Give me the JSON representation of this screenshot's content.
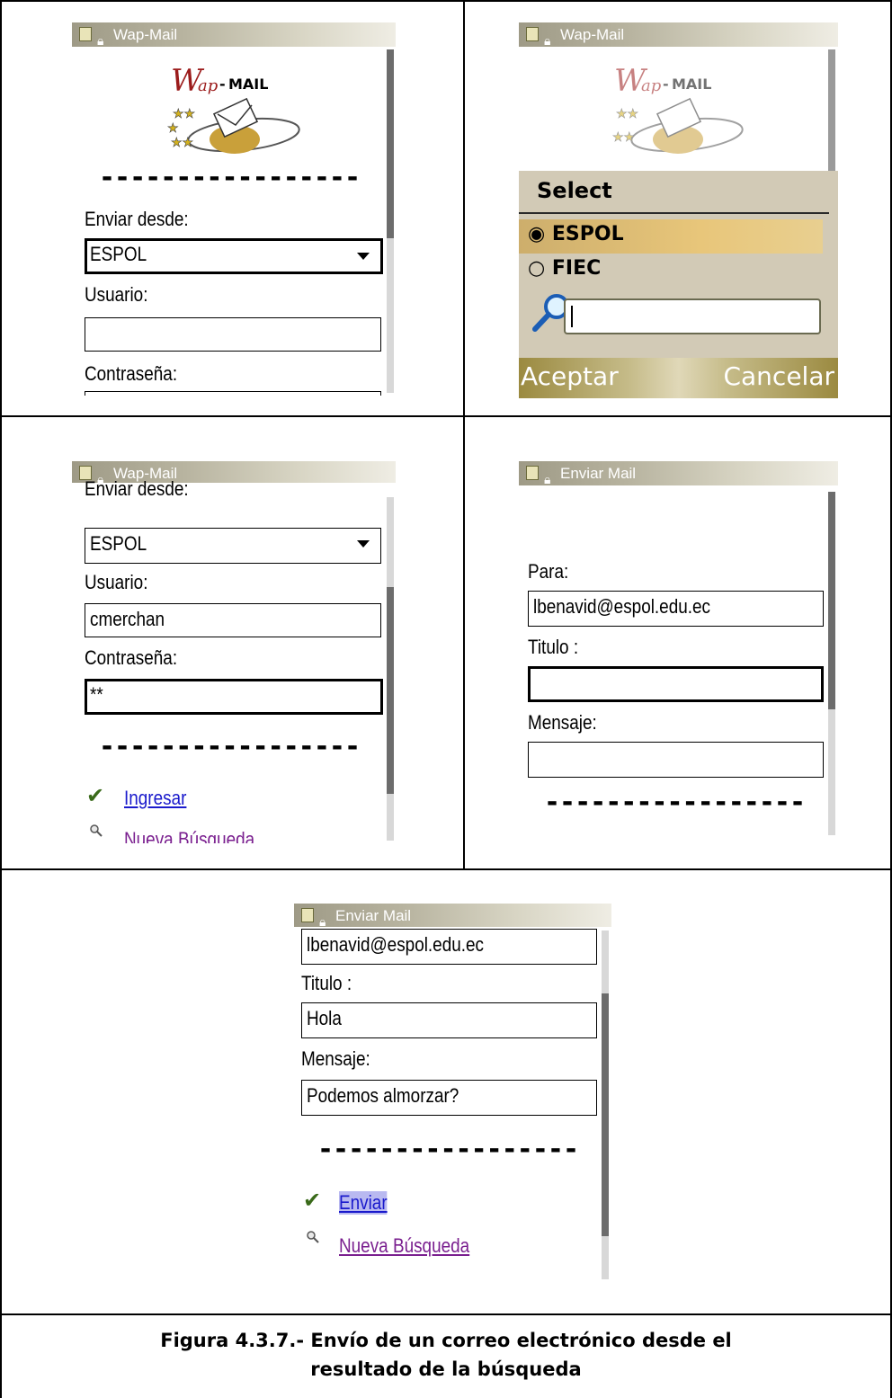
{
  "screens": {
    "login1": {
      "title": "Wap-Mail",
      "logo_text": "MAIL",
      "dashes": "-----------------",
      "send_from_label": "Enviar desde:",
      "send_from_value": "ESPOL",
      "user_label": "Usuario:",
      "user_value": "",
      "password_label": "Contraseña:"
    },
    "select": {
      "title": "Wap-Mail",
      "logo_text": "MAIL",
      "header": "Select",
      "options": [
        "ESPOL",
        "FIEC"
      ],
      "selected": "ESPOL",
      "search_value": "",
      "left_softkey": "Aceptar",
      "right_softkey": "Cancelar"
    },
    "login2": {
      "title": "Wap-Mail",
      "send_from_label": "Enviar desde:",
      "send_from_value": "ESPOL",
      "user_label": "Usuario:",
      "user_value": "cmerchan",
      "password_label": "Contraseña:",
      "password_value": "**",
      "dashes": "-----------------",
      "login_link": "Ingresar",
      "new_search_link": "Nueva Búsqueda"
    },
    "compose1": {
      "title": "Enviar Mail",
      "to_label": "Para:",
      "to_value": "lbenavid@espol.edu.ec",
      "subject_label": "Titulo :",
      "subject_value": "",
      "message_label": "Mensaje:",
      "message_value": "",
      "dashes": "-----------------"
    },
    "compose2": {
      "title": "Enviar Mail",
      "to_value": "lbenavid@espol.edu.ec",
      "subject_label": "Titulo :",
      "subject_value": "Hola",
      "message_label": "Mensaje:",
      "message_value": "Podemos almorzar?",
      "dashes": "-----------------",
      "send_link": "Enviar",
      "new_search_link": "Nueva Búsqueda"
    }
  },
  "caption": {
    "line1": "Figura 4.3.7.-  Envío de un correo electrónico desde el",
    "line2": "resultado de la búsqueda"
  },
  "colors": {
    "link_blue": "#1a1acc",
    "link_visited": "#7a1f8f",
    "select_bg": "#d2cab6",
    "select_highlight": "#e0bd74"
  }
}
